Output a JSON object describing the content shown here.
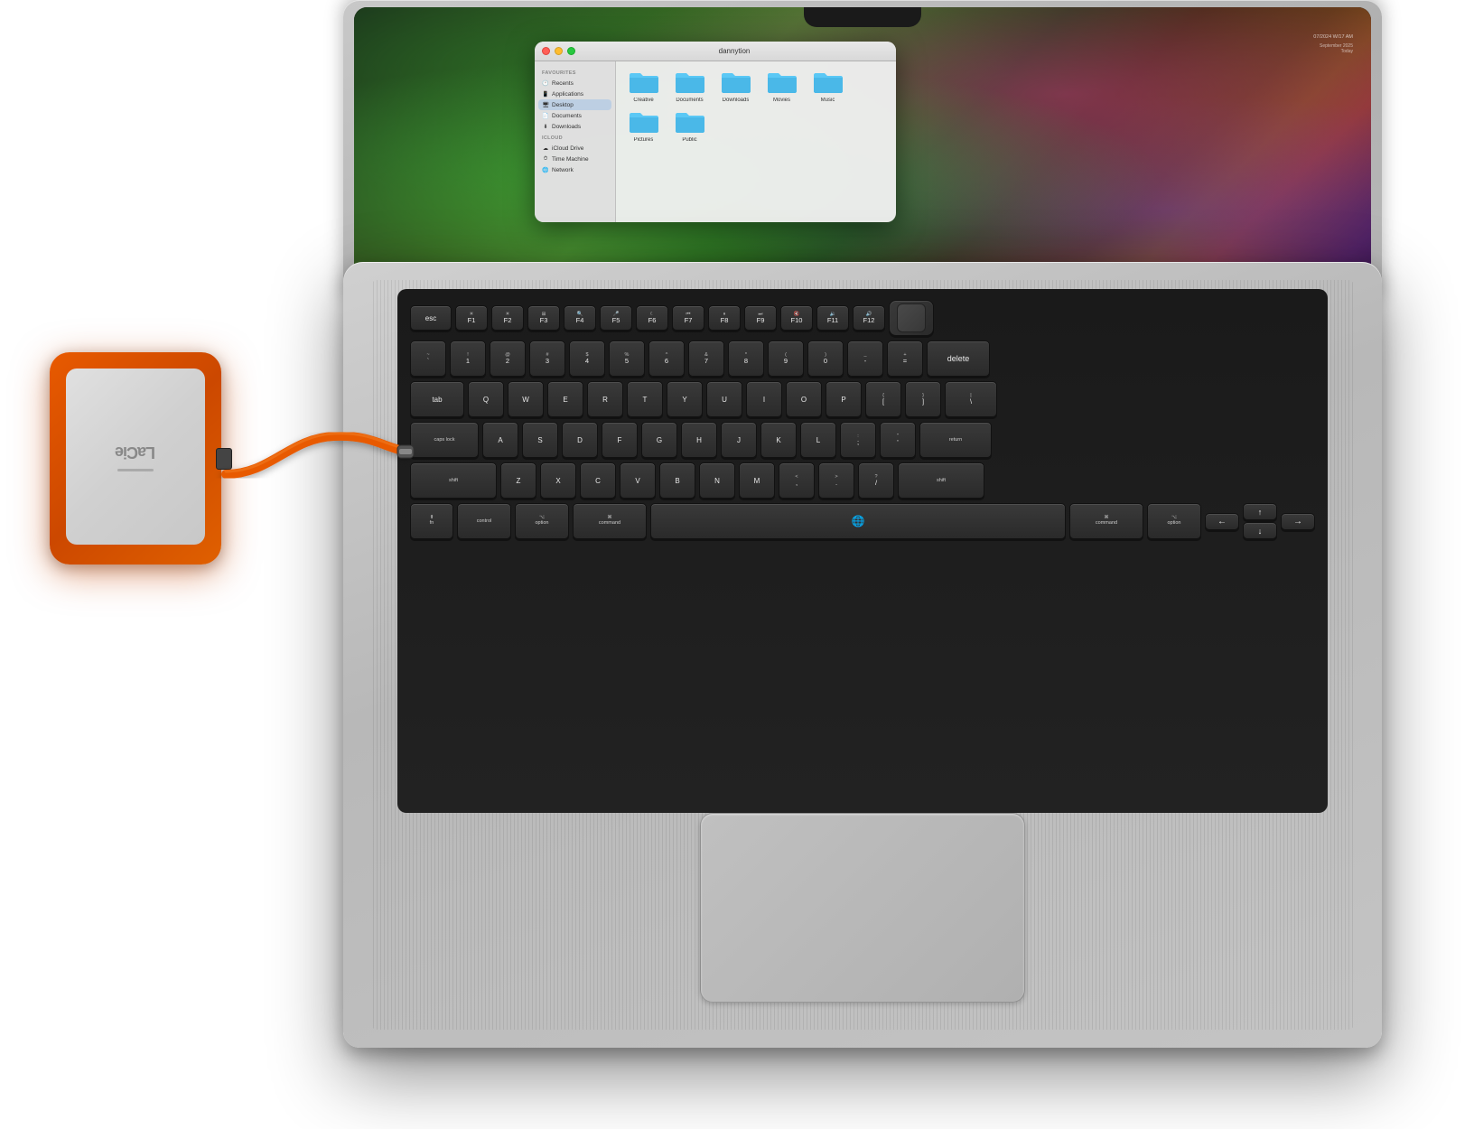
{
  "scene": {
    "background": "#ffffff"
  },
  "macbook": {
    "lid_color": "#c0c0c0",
    "body_color": "#b8b8b8"
  },
  "finder": {
    "title": "dannytion",
    "traffic_lights": [
      "red",
      "yellow",
      "green"
    ],
    "sidebar": {
      "sections": [
        {
          "header": "FAVOURITES",
          "items": [
            {
              "label": "Recents",
              "icon": "🕐"
            },
            {
              "label": "Applications",
              "icon": "📱"
            },
            {
              "label": "Desktop",
              "icon": "🖥"
            },
            {
              "label": "Documents",
              "icon": "📄"
            },
            {
              "label": "Downloads",
              "icon": "⬇"
            }
          ]
        },
        {
          "header": "iCLOUD",
          "items": [
            {
              "label": "iCloud Drive",
              "icon": "☁"
            },
            {
              "label": "Time Machine",
              "icon": "⏱"
            },
            {
              "label": "Network",
              "icon": "🌐"
            }
          ]
        }
      ]
    },
    "folders": [
      {
        "name": "Creative",
        "color": "#4ab8e8"
      },
      {
        "name": "Documents",
        "color": "#4ab8e8"
      },
      {
        "name": "Downloads",
        "color": "#4ab8e8"
      },
      {
        "name": "Movies",
        "color": "#4ab8e8"
      },
      {
        "name": "Music",
        "color": "#4ab8e8"
      },
      {
        "name": "Pictures",
        "color": "#4ab8e8"
      },
      {
        "name": "Public",
        "color": "#4ab8e8"
      }
    ]
  },
  "keyboard": {
    "rows": {
      "fn_row": [
        "esc",
        "F1",
        "F2",
        "F3",
        "F4",
        "F5",
        "F6",
        "F7",
        "F8",
        "F9",
        "F10",
        "F11",
        "F12"
      ],
      "num_row": [
        "`~",
        "1!",
        "2@",
        "3#",
        "4$",
        "5%",
        "6^",
        "7&",
        "8*",
        "9(",
        "0)",
        "-_",
        "+=",
        "delete"
      ],
      "qwerty": [
        "tab",
        "Q",
        "W",
        "E",
        "R",
        "T",
        "Y",
        "U",
        "I",
        "O",
        "P",
        "[{",
        "]}",
        "\\|"
      ],
      "home": [
        "caps lock",
        "A",
        "S",
        "D",
        "F",
        "G",
        "H",
        "J",
        "K",
        "L",
        ";:",
        "'\"",
        "return"
      ],
      "shift": [
        "shift",
        "Z",
        "X",
        "C",
        "V",
        "B",
        "N",
        "M",
        ",<",
        ".>",
        "/?",
        "shift"
      ],
      "bottom": [
        "fn",
        "control",
        "option",
        "command",
        "space",
        "command",
        "option",
        "←",
        "↑↓",
        "→"
      ]
    }
  },
  "lacie": {
    "brand": "LaCie",
    "logo_text": "LaCie",
    "color_orange": "#e85a00",
    "color_silver": "#d8d8d8"
  },
  "labels": {
    "option": "option",
    "command": "command",
    "control": "control",
    "fn": "fn",
    "caps_lock": "caps lock",
    "shift": "shift",
    "return": "return",
    "delete": "delete",
    "tab": "tab",
    "esc": "esc",
    "space": ""
  }
}
